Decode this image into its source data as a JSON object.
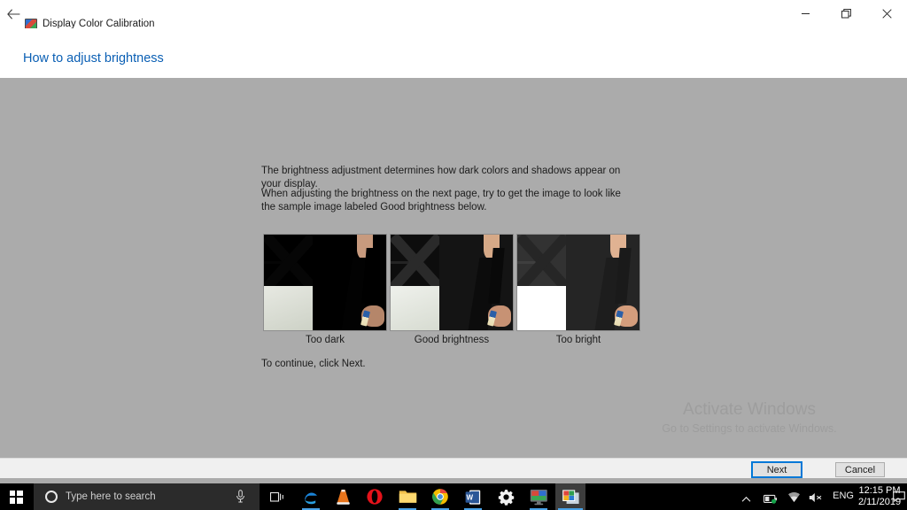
{
  "window": {
    "app_icon": "display-monitor-icon",
    "title": "Display Color Calibration",
    "back_icon": "back-arrow-icon",
    "minimize_icon": "minimize-icon",
    "maximize_icon": "restore-icon",
    "close_icon": "close-icon"
  },
  "header": {
    "link": "How to adjust brightness"
  },
  "content": {
    "paragraph1": "The brightness adjustment determines how dark colors and shadows appear on your display.",
    "paragraph2": "When adjusting the brightness on the next page, try to get the image to look like the sample image labeled Good brightness below.",
    "continue_text": "To continue, click Next.",
    "samples": [
      {
        "id": "too-dark",
        "caption": "Too dark"
      },
      {
        "id": "good-brightness",
        "caption": "Good brightness"
      },
      {
        "id": "too-bright",
        "caption": "Too bright"
      }
    ]
  },
  "watermark": {
    "title": "Activate Windows",
    "subtitle": "Go to Settings to activate Windows."
  },
  "footer": {
    "next_label": "Next",
    "cancel_label": "Cancel"
  },
  "taskbar": {
    "start_icon": "windows-logo-icon",
    "cortana_icon": "cortana-circle-icon",
    "search_placeholder": "Type here to search",
    "mic_icon": "microphone-icon",
    "taskview_icon": "task-view-icon",
    "apps": [
      {
        "name": "microsoft-edge",
        "label": "e"
      },
      {
        "name": "vlc-media-player",
        "label": ""
      },
      {
        "name": "opera-browser",
        "label": "O"
      },
      {
        "name": "file-explorer",
        "label": ""
      },
      {
        "name": "google-chrome",
        "label": ""
      },
      {
        "name": "microsoft-word",
        "label": "W"
      },
      {
        "name": "settings",
        "label": ""
      },
      {
        "name": "display-color-calibration",
        "label": ""
      },
      {
        "name": "photos-app",
        "label": ""
      }
    ],
    "tray": {
      "chevron_icon": "show-hidden-icons-chevron",
      "battery_icon": "battery-icon",
      "wifi_icon": "wifi-icon",
      "volume_icon": "volume-muted-icon",
      "language": "ENG",
      "time": "12:15 PM",
      "date": "2/11/2019",
      "notification_icon": "action-center-icon"
    }
  },
  "colors": {
    "body_background": "#ababab",
    "titlebar_background": "#ffffff",
    "link_blue": "#0a5fb4",
    "focus_blue": "#0078d7",
    "taskbar_background": "#000000",
    "footer_background": "#f0f0f0"
  }
}
